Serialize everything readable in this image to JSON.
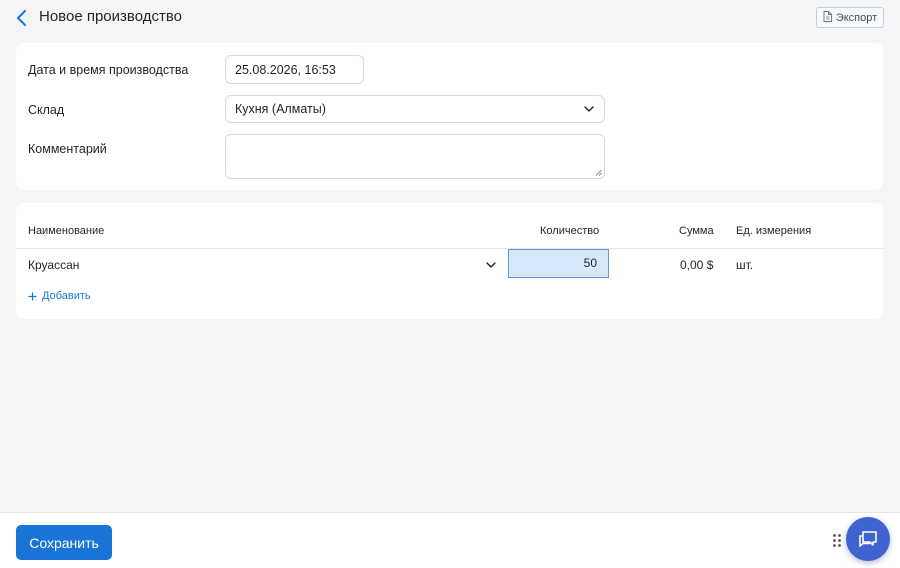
{
  "header": {
    "title": "Новое производство",
    "export_label": "Экспорт"
  },
  "form": {
    "datetime_label": "Дата и время производства",
    "datetime_value": "25.08.2026, 16:53",
    "warehouse_label": "Склад",
    "warehouse_value": "Кухня (Алматы)",
    "comment_label": "Комментарий",
    "comment_value": ""
  },
  "table": {
    "columns": [
      "Наименование",
      "Количество",
      "Сумма",
      "Ед. измерения"
    ],
    "rows": [
      {
        "name": "Круассан",
        "quantity": "50",
        "sum": "0,00 $",
        "unit": "шт."
      }
    ],
    "add_label": "Добавить"
  },
  "footer": {
    "save_label": "Сохранить"
  },
  "icons": {
    "back": "chevron-left-icon",
    "export": "document-icon",
    "select": "chevron-down-icon",
    "add": "plus-icon",
    "drag": "drag-handle-icon",
    "chat": "chat-icon"
  },
  "colors": {
    "accent": "#1a73d6",
    "qty_highlight": "#d7e8fb",
    "chat_button": "#3f64d1",
    "background": "#f4f5f7"
  }
}
